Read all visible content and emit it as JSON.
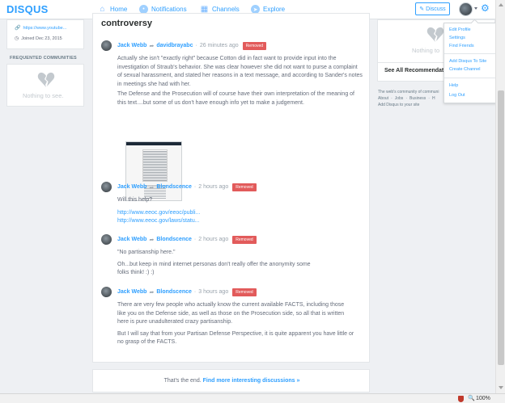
{
  "nav": {
    "logo": "DISQUS",
    "items": [
      {
        "label": "Home",
        "icon": "home-icon"
      },
      {
        "label": "Notifications",
        "icon": "notifications-icon"
      },
      {
        "label": "Channels",
        "icon": "channels-icon"
      },
      {
        "label": "Explore",
        "icon": "explore-icon"
      }
    ],
    "discuss_label": "Discuss",
    "accent": "#2e9fff"
  },
  "sidebar": {
    "link": "https://www.youtube...",
    "joined": "Joined Dec 23, 2015",
    "communities_title": "FREQUENTED COMMUNITIES",
    "empty_text": "Nothing to see."
  },
  "main": {
    "title": "controversy",
    "comments": [
      {
        "author": "Jack Webb",
        "reply_to": "davidbrayabc",
        "time": "26 minutes ago",
        "badge": "Removed",
        "body": [
          "Actually she isn't \"exactly right\" because Cotton did in fact want to provide input into the investigation of Straub's behavior. She was clear however she did not want to purse a complaint of sexual harassment, and stated her reasons in a text message, and according to Sander's notes in meetings she had with her.",
          "The Defense and the Prosecution will of course have their own interpretation of the meaning of this text....but some of us don't have enough info yet to make a judgement."
        ]
      },
      {
        "author": "Jack Webb",
        "reply_to": "Blondscence",
        "time": "2 hours ago",
        "badge": "Removed",
        "body": [
          "Will this help?"
        ],
        "links": [
          "http://www.eeoc.gov/eeoc/publi...",
          "http://www.eeoc.gov/laws/statu..."
        ]
      },
      {
        "author": "Jack Webb",
        "reply_to": "Blondscence",
        "time": "2 hours ago",
        "badge": "Removed",
        "body": [
          "\"No partisanship here.\"",
          "Oh...but keep in mind internet personas don't really offer the anonymity some folks think! :) :)"
        ]
      },
      {
        "author": "Jack Webb",
        "reply_to": "Blondscence",
        "time": "3 hours ago",
        "badge": "Removed",
        "body": [
          "There are very few people who actually know the current available FACTS, including those like you on the Defense side, as well as those on the Prosecution side, so all that is written here is pure unadulterated crazy partisanship.",
          "But I will say that from your Partisan Defense Perspective, it is quite apparent you have little or no grasp of the FACTS."
        ]
      }
    ],
    "end_text": "That's the end.",
    "end_link": "Find more interesting discussions »"
  },
  "right": {
    "empty_text": "Nothing to",
    "recommendations": "See All Recommendation",
    "footer_line1": "The web's community of communi",
    "footer_links": [
      "About",
      "Jobs",
      "Business",
      "H"
    ],
    "footer_line3": "Add Disqus to your site"
  },
  "menu": {
    "items": [
      "Edit Profile",
      "Settings",
      "Find Friends",
      "Add Disqus To Site",
      "Create Channel",
      "Help",
      "Log Out"
    ]
  },
  "statusbar": {
    "zoom": "100%"
  },
  "colors": {
    "accent": "#2e9fff",
    "removed": "#e25b5b"
  }
}
